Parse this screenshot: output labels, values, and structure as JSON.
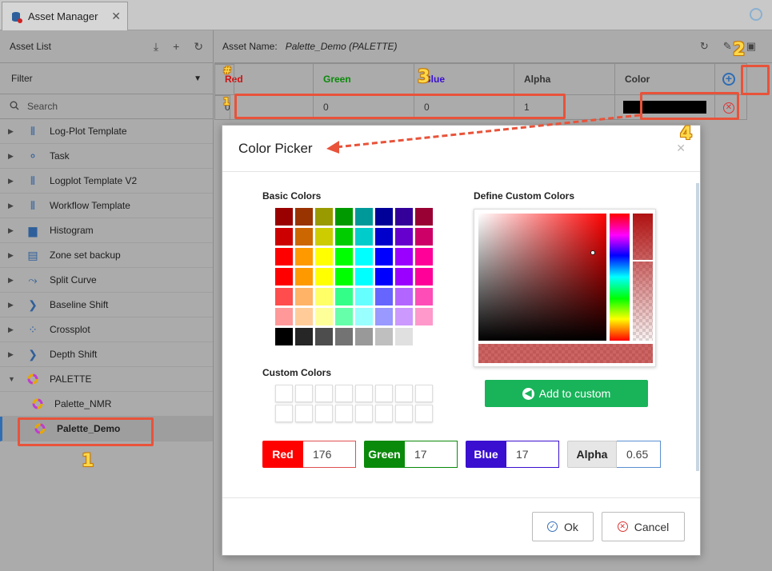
{
  "tab": {
    "title": "Asset Manager",
    "close": "✕"
  },
  "left": {
    "header": "Asset List",
    "filter": "Filter",
    "search_placeholder": "Search",
    "items": [
      {
        "label": "Log-Plot Template",
        "icon": "logplot-icon"
      },
      {
        "label": "Task",
        "icon": "task-icon"
      },
      {
        "label": "Logplot Template V2",
        "icon": "logplot-icon"
      },
      {
        "label": "Workflow Template",
        "icon": "workflow-icon"
      },
      {
        "label": "Histogram",
        "icon": "histogram-icon"
      },
      {
        "label": "Zone set backup",
        "icon": "zone-icon"
      },
      {
        "label": "Split Curve",
        "icon": "split-icon"
      },
      {
        "label": "Baseline Shift",
        "icon": "baseline-icon"
      },
      {
        "label": "Crossplot",
        "icon": "crossplot-icon"
      },
      {
        "label": "Depth Shift",
        "icon": "depth-icon"
      },
      {
        "label": "PALETTE",
        "icon": "palette-icon"
      }
    ],
    "children": [
      {
        "label": "Palette_NMR"
      },
      {
        "label": "Palette_Demo"
      }
    ]
  },
  "right": {
    "asset_label": "Asset Name:",
    "asset_value": "Palette_Demo (PALETTE)",
    "columns": {
      "num": "#",
      "red": "Red",
      "green": "Green",
      "blue": "Blue",
      "alpha": "Alpha",
      "color": "Color"
    },
    "row": {
      "num": "1",
      "red": "0",
      "green": "0",
      "blue": "0",
      "alpha": "1"
    }
  },
  "dialog": {
    "title": "Color Picker",
    "basic_title": "Basic Colors",
    "custom_title": "Custom Colors",
    "define_title": "Define Custom Colors",
    "add_label": "Add to custom",
    "red_label": "Red",
    "red_value": "176",
    "green_label": "Green",
    "green_value": "17",
    "blue_label": "Blue",
    "blue_value": "17",
    "alpha_label": "Alpha",
    "alpha_value": "0.65",
    "ok_label": "Ok",
    "cancel_label": "Cancel"
  },
  "basic_colors": [
    "#990000",
    "#993300",
    "#999900",
    "#009900",
    "#009999",
    "#000099",
    "#330099",
    "#990033",
    "#cc0000",
    "#cc6600",
    "#cccc00",
    "#00cc00",
    "#00cccc",
    "#0000cc",
    "#6600cc",
    "#cc0066",
    "#ff0000",
    "#ff9900",
    "#ffff00",
    "#00ff00",
    "#00ffff",
    "#0000ff",
    "#9900ff",
    "#ff0099",
    "#ff0000",
    "#ff9900",
    "#ffff00",
    "#00ff00",
    "#00ffff",
    "#0000ff",
    "#9900ff",
    "#ff0099",
    "#ff4d4d",
    "#ffb366",
    "#ffff66",
    "#33ff88",
    "#66ffff",
    "#6666ff",
    "#b366ff",
    "#ff4db8",
    "#ff9999",
    "#ffcc99",
    "#ffff99",
    "#66ffaa",
    "#99ffff",
    "#9999ff",
    "#cc99ff",
    "#ff99cc",
    "#000000",
    "#262626",
    "#4d4d4d",
    "#737373",
    "#999999",
    "#bfbfbf",
    "#e0e0e0",
    "#ffffff"
  ],
  "callouts": {
    "c1": "1",
    "c2": "2",
    "c3": "3",
    "c4": "4"
  },
  "colors": {
    "red_header": "#d01010",
    "green_header": "#0a8a0a",
    "blue_header": "#3a0fd0",
    "accent": "#19b35a"
  }
}
